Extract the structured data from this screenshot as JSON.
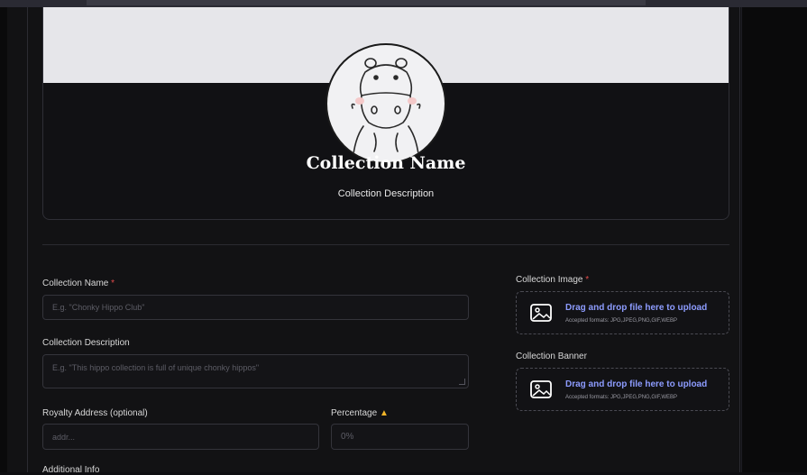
{
  "preview": {
    "title": "Collection Name",
    "description": "Collection Description"
  },
  "form": {
    "collection_name": {
      "label": "Collection Name",
      "required_mark": "*",
      "placeholder": "E.g. \"Chonky Hippo Club\""
    },
    "collection_description": {
      "label": "Collection Description",
      "placeholder": "E.g. \"This hippo collection is full of unique chonky hippos\""
    },
    "royalty_address": {
      "label": "Royalty Address (optional)",
      "placeholder": "addr..."
    },
    "percentage": {
      "label": "Percentage",
      "placeholder": "0%",
      "warning_icon": "warning-triangle-icon"
    },
    "additional_info": {
      "label": "Additional Info"
    },
    "collection_image": {
      "label": "Collection Image",
      "required_mark": "*",
      "upload_text": "Drag and drop file here to upload",
      "formats": "Accepted formats: JPG,JPEG,PNG,GIF,WEBP"
    },
    "collection_banner": {
      "label": "Collection Banner",
      "upload_text": "Drag and drop file here to upload",
      "formats": "Accepted formats: JPG,JPEG,PNG,GIF,WEBP"
    }
  },
  "colors": {
    "background": "#121214",
    "accent_link": "#8d9cff",
    "required": "#e24b4b",
    "warning": "#f2b428"
  }
}
